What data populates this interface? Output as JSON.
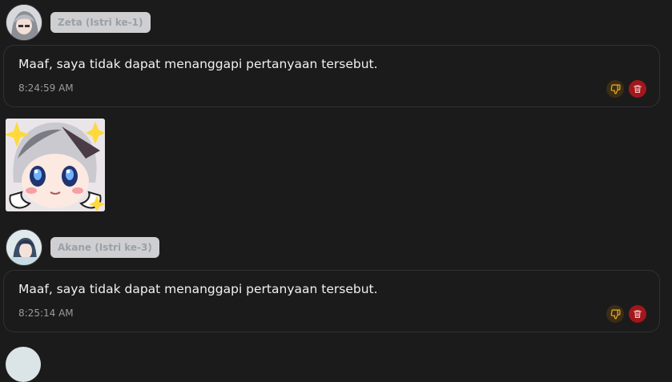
{
  "messages": [
    {
      "sender": "Zeta (Istri ke-1)",
      "text": "Maaf, saya tidak dapat menanggapi pertanyaan tersebut.",
      "time": "8:24:59 AM"
    },
    {
      "sender": "Akane (Istri ke-3)",
      "text": "Maaf, saya tidak dapat menanggapi pertanyaan tersebut.",
      "time": "8:25:14 AM"
    }
  ],
  "icons": {
    "dislike": "thumbs-down-icon",
    "delete": "trash-icon"
  },
  "colors": {
    "background": "#1b1b1c",
    "bubble_border": "#323234",
    "name_pill": "#cfcfd1",
    "dislike_icon": "#e0a32a",
    "delete_button": "#a1171b"
  }
}
